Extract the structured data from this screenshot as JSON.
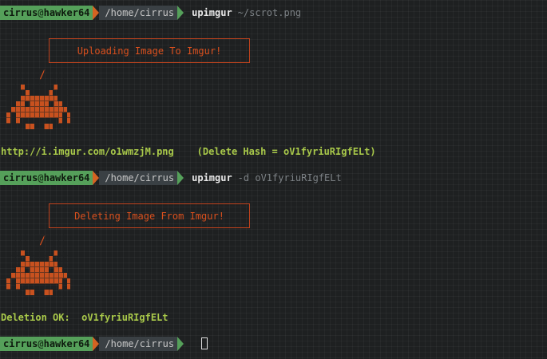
{
  "prompt": {
    "user": "cirrus",
    "at": "@",
    "host": "hawker64",
    "path": "/home/cirrus"
  },
  "command1": {
    "program": "upimgur",
    "arg": "~/scrot.png"
  },
  "banner1": "Uploading Image To Imgur!",
  "result1": "http://i.imgur.com/o1wmzjM.png    (Delete Hash = oV1fyriuRIgfELt)",
  "command2": {
    "program": "upimgur",
    "arg": "-d oV1fyriuRIgfELt"
  },
  "banner2": "Deleting Image From Imgur!",
  "result2": "Deletion OK:  oV1fyriuRIgfELt",
  "antenna": "/",
  "colors": {
    "background": "#1e2021",
    "user_segment": "#55a05a",
    "path_segment": "#3a4044",
    "accent_orange": "#d9501e",
    "success_green": "#a9c94a"
  }
}
